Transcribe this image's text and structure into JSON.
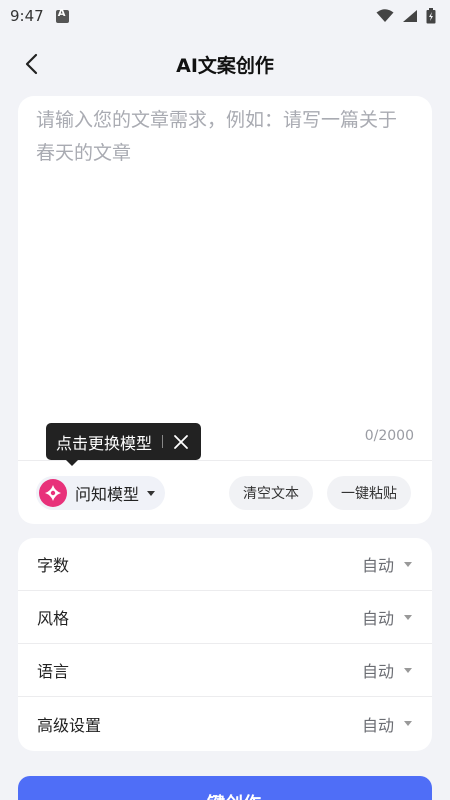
{
  "status_bar": {
    "time": "9:47",
    "icons": [
      "notification-a-icon",
      "wifi-icon",
      "signal-icon",
      "battery-icon"
    ]
  },
  "header": {
    "title": "AI文案创作",
    "back_icon": "back-arrow-icon"
  },
  "editor": {
    "placeholder": "请输入您的文章需求，例如：请写一篇关于春天的文章",
    "char_count": "0/2000"
  },
  "model": {
    "name": "问知模型",
    "logo_color": "#e8317a"
  },
  "tooltip": {
    "text": "点击更换模型"
  },
  "actions": {
    "clear_label": "清空文本",
    "paste_label": "一键粘贴"
  },
  "settings": [
    {
      "label": "字数",
      "value": "自动"
    },
    {
      "label": "风格",
      "value": "自动"
    },
    {
      "label": "语言",
      "value": "自动"
    },
    {
      "label": "高级设置",
      "value": "自动"
    }
  ],
  "create_button": {
    "label": "一键创作"
  },
  "colors": {
    "accent": "#4f6ef7",
    "background": "#f2f3f7"
  }
}
